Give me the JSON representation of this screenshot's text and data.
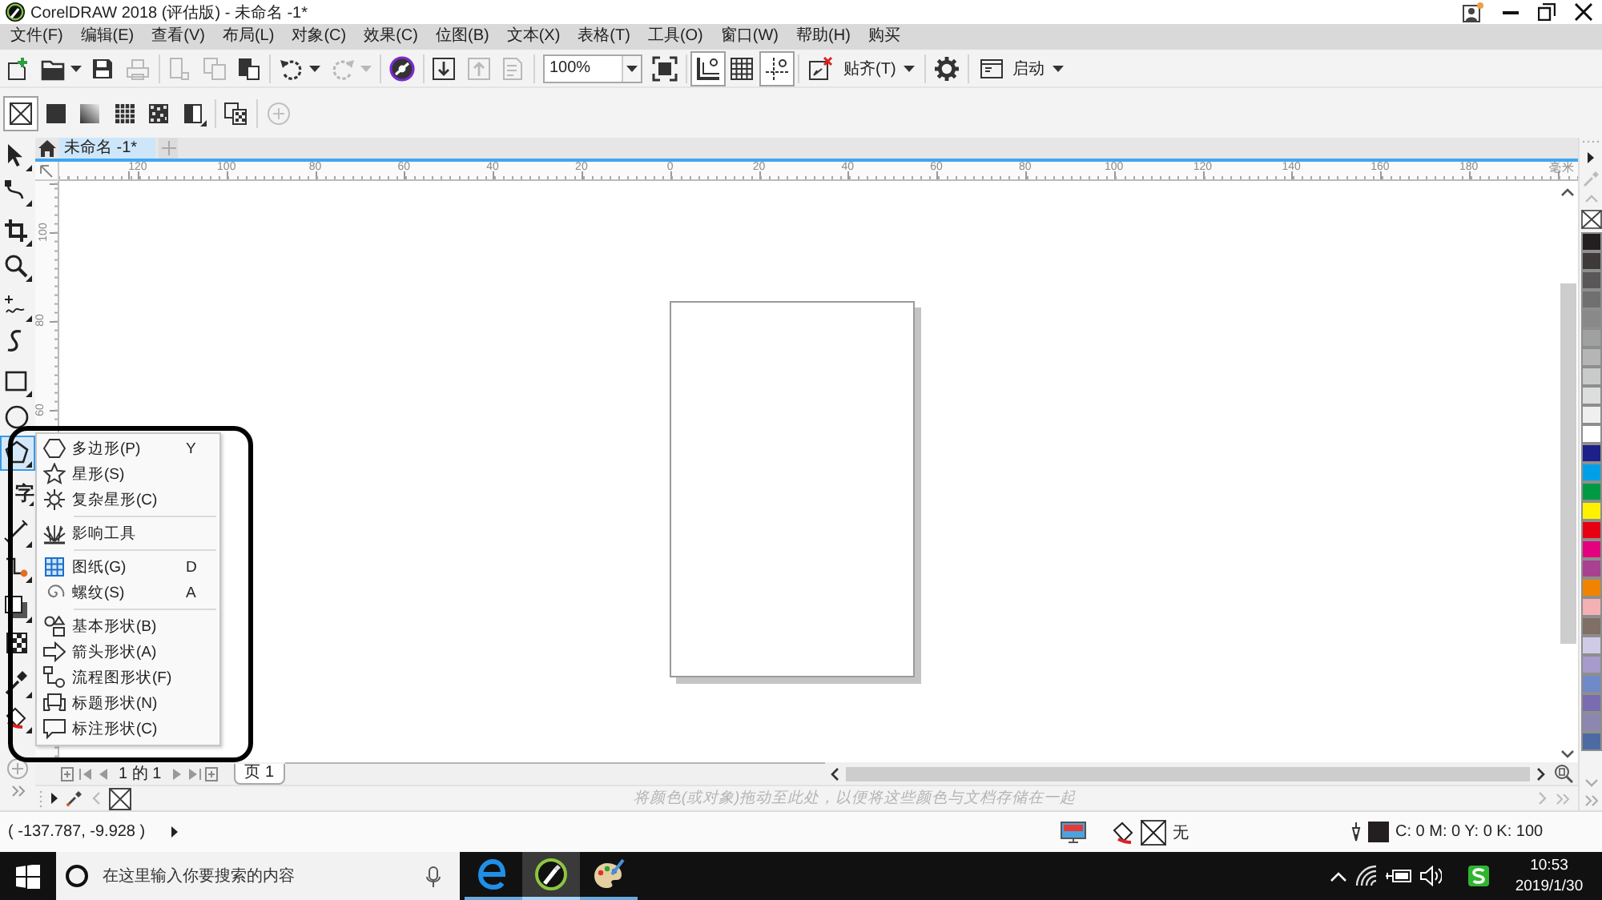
{
  "window": {
    "title": "CorelDRAW 2018 (评估版) - 未命名 -1*"
  },
  "menu": [
    "文件(F)",
    "编辑(E)",
    "查看(V)",
    "布局(L)",
    "对象(C)",
    "效果(C)",
    "位图(B)",
    "文本(X)",
    "表格(T)",
    "工具(O)",
    "窗口(W)",
    "帮助(H)",
    "购买"
  ],
  "standard_toolbar": {
    "groups": [
      [
        {
          "kind": "new",
          "disabled": false
        },
        {
          "kind": "open",
          "disabled": false,
          "dropdown": true
        },
        {
          "kind": "save",
          "disabled": false
        },
        {
          "kind": "print",
          "disabled": true
        }
      ],
      [
        {
          "kind": "cut",
          "disabled": true
        },
        {
          "kind": "copy",
          "disabled": true
        },
        {
          "kind": "paste",
          "disabled": false
        }
      ],
      [
        {
          "kind": "undo",
          "disabled": false,
          "dropdown": true
        },
        {
          "kind": "redo",
          "disabled": true,
          "dropdown": true
        }
      ],
      [
        {
          "kind": "connect",
          "disabled": false
        }
      ],
      [
        {
          "kind": "import",
          "disabled": false
        },
        {
          "kind": "export",
          "disabled": true
        },
        {
          "kind": "pdf",
          "disabled": true
        }
      ],
      [
        {
          "kind": "zoom",
          "value": "100%",
          "disabled": false
        },
        {
          "kind": "fullscreen",
          "disabled": false
        }
      ],
      [
        {
          "kind": "rulers",
          "on": true
        },
        {
          "kind": "grid",
          "on": false
        },
        {
          "kind": "guidelines",
          "on": true
        }
      ],
      [
        {
          "kind": "snap-off",
          "disabled": false
        },
        {
          "kind": "snap-to",
          "label": "贴齐(T)",
          "disabled": false
        }
      ],
      [
        {
          "kind": "options",
          "disabled": false
        }
      ],
      [
        {
          "kind": "launch",
          "label": "启动",
          "disabled": false
        }
      ]
    ]
  },
  "property_bar": {
    "groups": [
      [
        {
          "kind": "no-fill",
          "selected": true
        },
        {
          "kind": "uniform",
          "selected": false
        },
        {
          "kind": "fountain",
          "selected": false
        },
        {
          "kind": "vector-pattern",
          "selected": false
        },
        {
          "kind": "bitmap-pattern",
          "selected": false
        },
        {
          "kind": "postscript",
          "selected": false
        }
      ],
      [
        {
          "kind": "copy-fill",
          "disabled": false
        }
      ],
      [
        {
          "kind": "add",
          "disabled": true
        }
      ]
    ]
  },
  "document_tabs": [
    {
      "label": "未命名 -1*",
      "selected": true
    }
  ],
  "toolbox": {
    "groups": [
      [
        {
          "kind": "pick",
          "selected": false,
          "flyout": true
        },
        {
          "kind": "shape",
          "selected": false,
          "flyout": true
        }
      ],
      [
        {
          "kind": "crop",
          "selected": false,
          "flyout": true
        },
        {
          "kind": "zoom",
          "selected": false,
          "flyout": true
        }
      ],
      [
        {
          "kind": "freehand",
          "selected": false,
          "flyout": true
        },
        {
          "kind": "artistic",
          "selected": false,
          "flyout": false
        }
      ],
      [
        {
          "kind": "rectangle",
          "selected": false,
          "flyout": true
        },
        {
          "kind": "ellipse",
          "selected": false,
          "flyout": false
        },
        {
          "kind": "polygon",
          "selected": true,
          "flyout": true
        }
      ],
      [
        {
          "kind": "text",
          "glyph": "字",
          "selected": false,
          "flyout": true
        }
      ],
      [
        {
          "kind": "dimension",
          "selected": false,
          "flyout": true
        },
        {
          "kind": "connector",
          "selected": false,
          "flyout": true
        }
      ],
      [
        {
          "kind": "shadow",
          "selected": false,
          "flyout": true
        },
        {
          "kind": "transparency",
          "selected": false,
          "flyout": false
        }
      ],
      [
        {
          "kind": "eyedropper",
          "selected": false,
          "flyout": true
        },
        {
          "kind": "fill",
          "selected": false,
          "flyout": true
        }
      ]
    ]
  },
  "flyout": {
    "sections": [
      [
        {
          "kind": "polygon",
          "label": "多边形(P)",
          "shortcut": "Y"
        },
        {
          "kind": "star",
          "label": "星形(S)"
        },
        {
          "kind": "complex-star",
          "label": "复杂星形(C)"
        }
      ],
      [
        {
          "kind": "impact",
          "label": "影响工具"
        }
      ],
      [
        {
          "kind": "graph-paper",
          "label": "图纸(G)",
          "shortcut": "D"
        },
        {
          "kind": "spiral",
          "label": "螺纹(S)",
          "shortcut": "A"
        }
      ],
      [
        {
          "kind": "basic-shapes",
          "label": "基本形状(B)"
        },
        {
          "kind": "arrow-shapes",
          "label": "箭头形状(A)"
        },
        {
          "kind": "flowchart",
          "label": "流程图形状(F)"
        },
        {
          "kind": "banner",
          "label": "标题形状(N)"
        },
        {
          "kind": "callout",
          "label": "标注形状(C)"
        }
      ]
    ]
  },
  "rulers": {
    "horizontal": [
      "120",
      "100",
      "80",
      "60",
      "40",
      "20",
      "0",
      "20",
      "40",
      "60",
      "80",
      "100",
      "120",
      "140",
      "160",
      "180"
    ],
    "unit": "毫米",
    "vertical": [
      "100",
      "80",
      "60"
    ]
  },
  "page_nav": {
    "counter": "1 的 1",
    "pages": [
      {
        "label": "页 1",
        "selected": true
      }
    ]
  },
  "document_palette": {
    "hint": "将颜色(或对象)拖动至此处，以便将这些颜色与文档存储在一起"
  },
  "color_palette": {
    "swatches": [
      {
        "color": "#231f20"
      },
      {
        "color": "#3e3a39"
      },
      {
        "color": "#595757"
      },
      {
        "color": "#717071"
      },
      {
        "color": "#898989"
      },
      {
        "color": "#9fa0a0"
      },
      {
        "color": "#b5b5b6"
      },
      {
        "color": "#c9caca"
      },
      {
        "color": "#dcdddd"
      },
      {
        "color": "#efefef"
      },
      {
        "color": "#ffffff"
      },
      {
        "color": "#1d2088"
      },
      {
        "color": "#00a0e9"
      },
      {
        "color": "#009944"
      },
      {
        "color": "#fff100"
      },
      {
        "color": "#e60012"
      },
      {
        "color": "#e4007f"
      },
      {
        "color": "#a94190"
      },
      {
        "color": "#f08300"
      },
      {
        "color": "#f3b1b3"
      },
      {
        "color": "#7f6f65"
      },
      {
        "color": "#cfcbe6"
      },
      {
        "color": "#a69bcb"
      },
      {
        "color": "#6f8ac8"
      },
      {
        "color": "#7a6cb0"
      },
      {
        "color": "#8c86b1"
      },
      {
        "color": "#4c6ba3"
      }
    ]
  },
  "status_bar": {
    "coordinates": "( -137.787, -9.928 )",
    "fill": "无",
    "outline": {
      "color": "#231f20",
      "reading": "C: 0 M: 0 Y: 0 K: 100"
    }
  },
  "taskbar": {
    "search": {
      "placeholder": "在这里输入你要搜索的内容"
    },
    "apps": [
      {
        "kind": "edge",
        "active": false
      },
      {
        "kind": "corel",
        "active": true
      },
      {
        "kind": "paint",
        "active": false
      }
    ],
    "time": "10:53",
    "date": "2019/1/30"
  }
}
